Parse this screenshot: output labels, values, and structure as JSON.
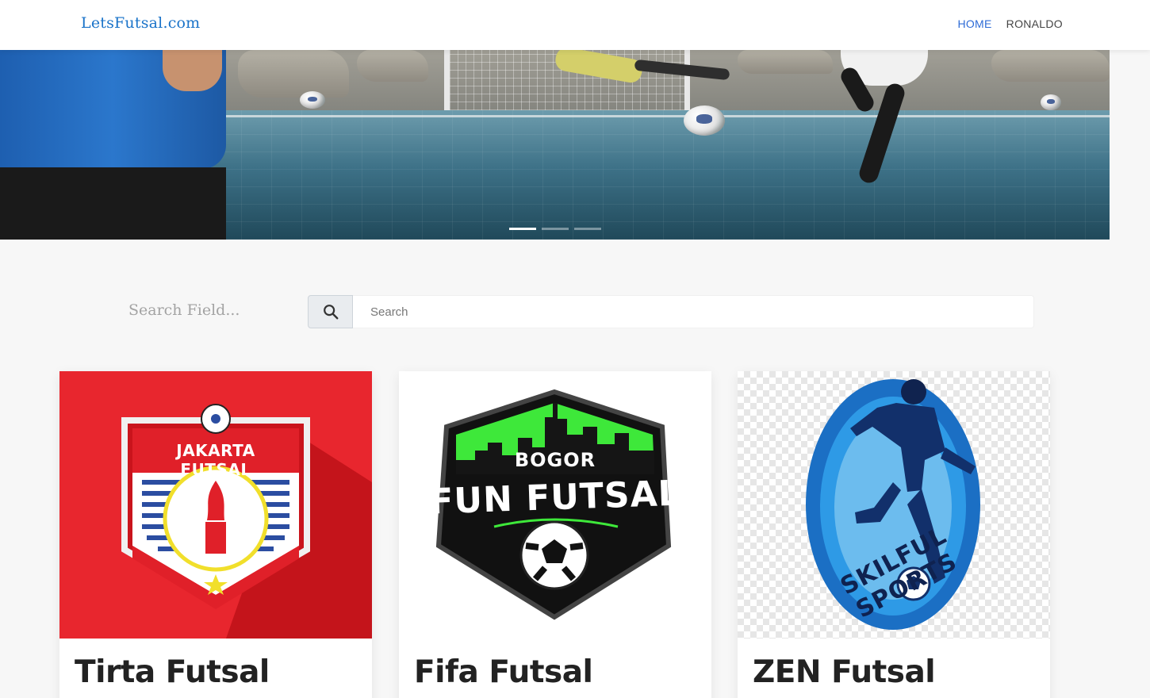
{
  "navbar": {
    "brand": "LetsFutsal.com",
    "links": [
      {
        "label": "HOME",
        "active": true
      },
      {
        "label": "RONALDO",
        "active": false
      }
    ]
  },
  "hero": {
    "slide_count": 3,
    "active_slide": 1
  },
  "search": {
    "label": "Search Field...",
    "placeholder": "Search",
    "button_icon": "search-icon"
  },
  "cards": [
    {
      "title": "Tirta Futsal",
      "logo_text": "JAKARTA FUTSAL",
      "logo_bg": "#e8262e"
    },
    {
      "title": "Fifa Futsal",
      "logo_text_top": "BOGOR",
      "logo_text_main": "FUN FUTSAL",
      "accent": "#3ee83a"
    },
    {
      "title": "ZEN Futsal",
      "logo_text": "SKILFUL SPORTS",
      "accent": "#1b4fa8"
    }
  ],
  "colors": {
    "brand": "#1a73c9",
    "nav_active": "#2d6bd6",
    "background": "#f7f7f7"
  }
}
